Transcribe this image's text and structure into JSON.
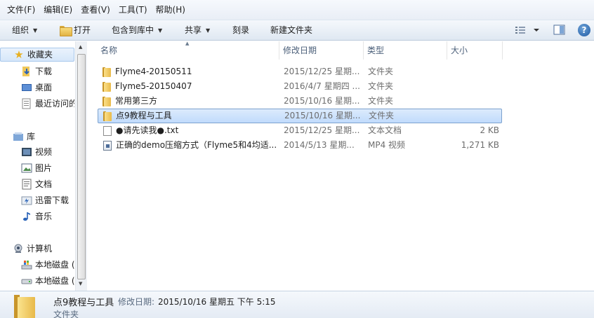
{
  "menubar": {
    "items": [
      "文件(F)",
      "编辑(E)",
      "查看(V)",
      "工具(T)",
      "帮助(H)"
    ]
  },
  "toolbar": {
    "organize": "组织",
    "open": "打开",
    "include_in_library": "包含到库中",
    "share": "共享",
    "burn": "刻录",
    "new_folder": "新建文件夹",
    "help": "?"
  },
  "nav": {
    "favorites": "收藏夹",
    "downloads": "下载",
    "desktop": "桌面",
    "recent": "最近访问的",
    "libraries": "库",
    "videos": "视频",
    "pictures": "图片",
    "documents": "文档",
    "thunder": "迅雷下载",
    "music": "音乐",
    "computer": "计算机",
    "disk1": "本地磁盘 (",
    "disk2": "本地磁盘 ("
  },
  "columns": {
    "name": "名称",
    "date": "修改日期",
    "type": "类型",
    "size": "大小"
  },
  "files": [
    {
      "name": "Flyme4-20150511",
      "date": "2015/12/25 星期...",
      "type": "文件夹",
      "size": "",
      "icon": "folder-icon"
    },
    {
      "name": "Flyme5-20150407",
      "date": "2016/4/7 星期四 ...",
      "type": "文件夹",
      "size": "",
      "icon": "folder-icon"
    },
    {
      "name": "常用第三方",
      "date": "2015/10/16 星期...",
      "type": "文件夹",
      "size": "",
      "icon": "folder-icon"
    },
    {
      "name": "点9教程与工具",
      "date": "2015/10/16 星期...",
      "type": "文件夹",
      "size": "",
      "icon": "folder-icon",
      "selected": true
    },
    {
      "name": "●请先读我●.txt",
      "date": "2015/12/25 星期...",
      "type": "文本文档",
      "size": "2 KB",
      "icon": "text-file-icon"
    },
    {
      "name": "正确的demo压缩方式（Flyme5和4均适...",
      "date": "2014/5/13 星期...",
      "type": "MP4 视频",
      "size": "1,271 KB",
      "icon": "video-file-icon"
    }
  ],
  "details": {
    "name": "点9教程与工具",
    "modified_label": "修改日期:",
    "modified_value": "2015/10/16 星期五 下午 5:15",
    "type": "文件夹"
  }
}
